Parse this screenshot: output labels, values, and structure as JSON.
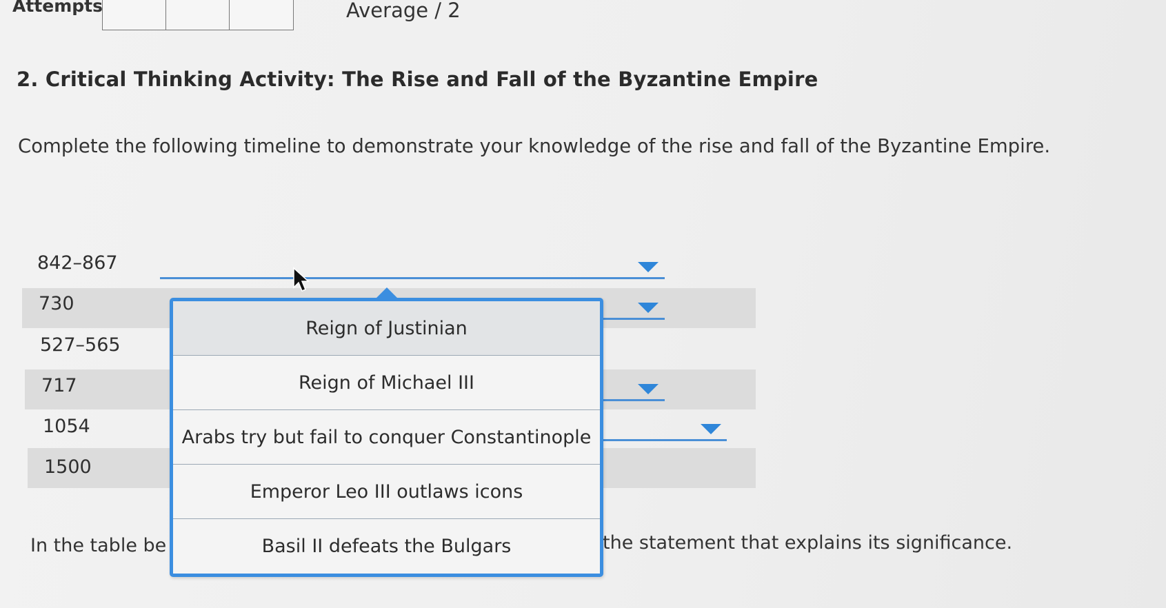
{
  "header": {
    "attempts_label": "Attempts",
    "average_label": "Average / 2"
  },
  "question": {
    "title": "2. Critical Thinking Activity: The Rise and Fall of the Byzantine Empire",
    "instructions": "Complete the following timeline to demonstrate your knowledge of the rise and fall of the Byzantine Empire."
  },
  "timeline": {
    "years": [
      "842–867",
      "730",
      "527–565",
      "717",
      "1054",
      "1500"
    ]
  },
  "dropdown": {
    "options": [
      "Reign of Justinian",
      "Reign of Michael III",
      "Arabs try but fail to conquer Constantinople",
      "Emperor Leo III outlaws icons",
      "Basil II defeats the Bulgars"
    ]
  },
  "footer": {
    "left_text": "In the table be",
    "right_text": "the statement that explains its significance."
  },
  "colors": {
    "accent": "#3b8ee0",
    "row_shade": "#dcdcdc"
  }
}
